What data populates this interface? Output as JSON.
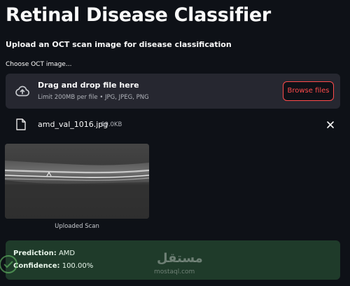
{
  "page": {
    "title": "Retinal Disease Classifier",
    "subtitle": "Upload an OCT scan image for disease classification"
  },
  "uploader": {
    "label": "Choose OCT image...",
    "drop_title": "Drag and drop file here",
    "limit_text": "Limit 200MB per file • JPG, JPEG, PNG",
    "browse_label": "Browse files",
    "icon": "cloud-upload-icon"
  },
  "file": {
    "name": "amd_val_1016.jpg",
    "size": "60.0KB",
    "icon": "file-icon",
    "remove_icon": "close-icon"
  },
  "image": {
    "caption": "Uploaded Scan"
  },
  "result": {
    "prediction_label": "Prediction:",
    "prediction_value": "AMD",
    "confidence_label": "Confidence:",
    "confidence_value": "100.00%",
    "background_color": "#1f3b2a"
  },
  "watermark": {
    "logo_text": "مستقل",
    "url": "mostaql.com"
  },
  "colors": {
    "background": "#0e1117",
    "accent": "#ff4b4b",
    "dropzone": "#262730"
  }
}
